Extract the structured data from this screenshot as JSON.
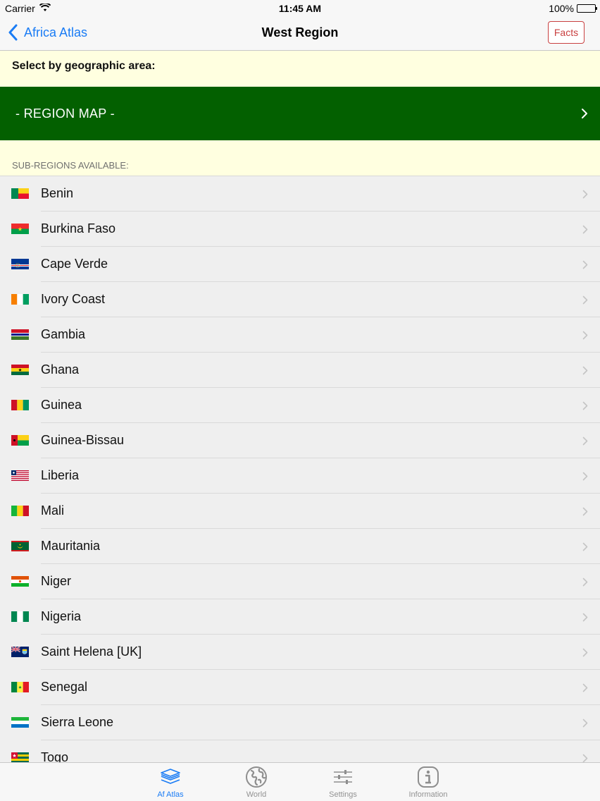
{
  "status_bar": {
    "carrier": "Carrier",
    "time": "11:45 AM",
    "battery": "100%"
  },
  "nav": {
    "back_label": "Africa Atlas",
    "title": "West Region",
    "facts_label": "Facts"
  },
  "select_label": "Select by geographic area:",
  "region_map_label": "- REGION MAP -",
  "sub_regions_label": "SUB-REGIONS AVAILABLE:",
  "countries": [
    {
      "name": "Benin",
      "flag": "benin"
    },
    {
      "name": "Burkina Faso",
      "flag": "burkina-faso"
    },
    {
      "name": "Cape Verde",
      "flag": "cape-verde"
    },
    {
      "name": "Ivory Coast",
      "flag": "ivory-coast"
    },
    {
      "name": "Gambia",
      "flag": "gambia"
    },
    {
      "name": "Ghana",
      "flag": "ghana"
    },
    {
      "name": "Guinea",
      "flag": "guinea"
    },
    {
      "name": "Guinea-Bissau",
      "flag": "guinea-bissau"
    },
    {
      "name": "Liberia",
      "flag": "liberia"
    },
    {
      "name": "Mali",
      "flag": "mali"
    },
    {
      "name": "Mauritania",
      "flag": "mauritania"
    },
    {
      "name": "Niger",
      "flag": "niger"
    },
    {
      "name": "Nigeria",
      "flag": "nigeria"
    },
    {
      "name": "Saint Helena [UK]",
      "flag": "saint-helena"
    },
    {
      "name": "Senegal",
      "flag": "senegal"
    },
    {
      "name": "Sierra Leone",
      "flag": "sierra-leone"
    },
    {
      "name": "Togo",
      "flag": "togo"
    }
  ],
  "tabs": [
    {
      "label": "Af Atlas",
      "icon": "layers-icon",
      "active": true
    },
    {
      "label": "World",
      "icon": "globe-icon",
      "active": false
    },
    {
      "label": "Settings",
      "icon": "sliders-icon",
      "active": false
    },
    {
      "label": "Information",
      "icon": "info-icon",
      "active": false
    }
  ],
  "colors": {
    "accent": "#1a7cf5",
    "region_map_bg": "#036000",
    "header_bg": "#ffffe0",
    "facts": "#c94040"
  }
}
